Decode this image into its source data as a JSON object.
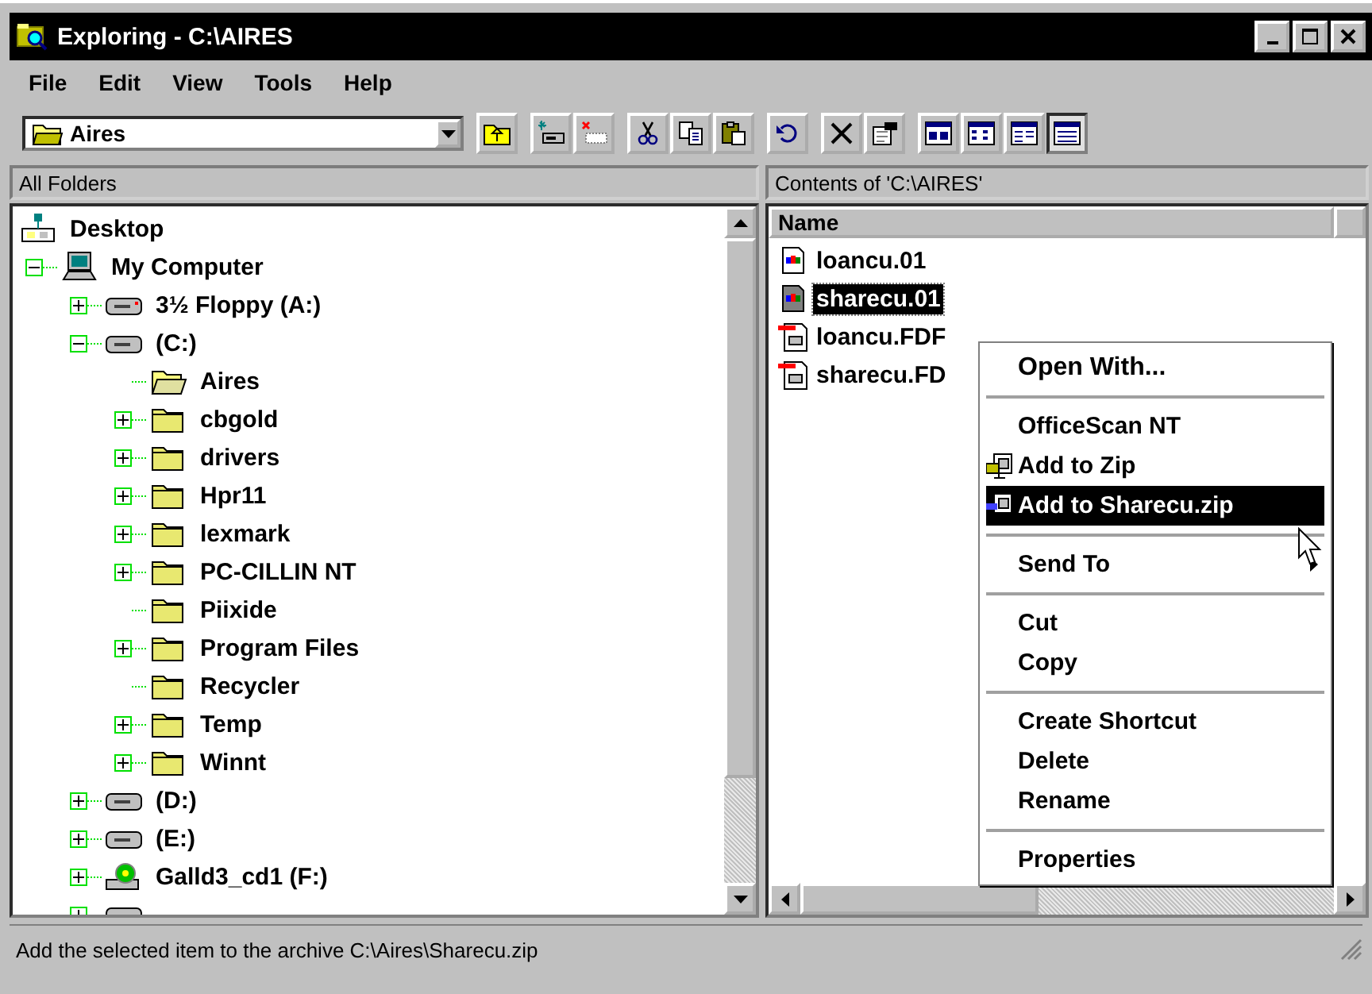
{
  "window": {
    "title": "Exploring - C:\\AIRES"
  },
  "menu": [
    {
      "label": "File"
    },
    {
      "label": "Edit"
    },
    {
      "label": "View"
    },
    {
      "label": "Tools"
    },
    {
      "label": "Help"
    }
  ],
  "toolbar": {
    "location": {
      "value": "Aires"
    },
    "buttons": [
      {
        "kind": "up",
        "selected": false
      },
      {
        "kind": "map-drive",
        "selected": false
      },
      {
        "kind": "disconnect",
        "selected": false
      },
      {
        "kind": "cut",
        "selected": false
      },
      {
        "kind": "copy",
        "selected": false
      },
      {
        "kind": "paste",
        "selected": false
      },
      {
        "kind": "undo",
        "selected": false
      },
      {
        "kind": "delete",
        "selected": false
      },
      {
        "kind": "properties",
        "selected": false
      },
      {
        "kind": "large-icons",
        "selected": false
      },
      {
        "kind": "small-icons",
        "selected": false
      },
      {
        "kind": "list",
        "selected": false
      },
      {
        "kind": "details",
        "selected": true
      }
    ]
  },
  "tree": {
    "header": "All Folders",
    "items": [
      {
        "label": "Desktop",
        "kind": "desktop",
        "children": [
          {
            "label": "My Computer",
            "kind": "computer",
            "expanded": true,
            "children": [
              {
                "label": "3½ Floppy (A:)",
                "kind": "floppy",
                "expanded": false
              },
              {
                "label": "(C:)",
                "kind": "drive",
                "expanded": true,
                "children": [
                  {
                    "label": "Aires",
                    "kind": "folder-open"
                  },
                  {
                    "label": "cbgold",
                    "kind": "folder",
                    "expanded": false
                  },
                  {
                    "label": "drivers",
                    "kind": "folder",
                    "expanded": false
                  },
                  {
                    "label": "Hpr11",
                    "kind": "folder",
                    "expanded": false
                  },
                  {
                    "label": "lexmark",
                    "kind": "folder",
                    "expanded": false
                  },
                  {
                    "label": "PC-CILLIN NT",
                    "kind": "folder",
                    "expanded": false
                  },
                  {
                    "label": "Piixide",
                    "kind": "folder"
                  },
                  {
                    "label": "Program Files",
                    "kind": "folder",
                    "expanded": false
                  },
                  {
                    "label": "Recycler",
                    "kind": "folder"
                  },
                  {
                    "label": "Temp",
                    "kind": "folder",
                    "expanded": false
                  },
                  {
                    "label": "Winnt",
                    "kind": "folder",
                    "expanded": false
                  }
                ]
              },
              {
                "label": "(D:)",
                "kind": "drive",
                "expanded": false
              },
              {
                "label": "(E:)",
                "kind": "drive",
                "expanded": false
              },
              {
                "label": "Galld3_cd1 (F:)",
                "kind": "cdrom",
                "expanded": false
              },
              {
                "kind": "network-drive",
                "expanded": false
              }
            ]
          }
        ]
      }
    ]
  },
  "contents": {
    "header": "Contents of 'C:\\AIRES'",
    "columns": [
      "Name"
    ],
    "files": [
      {
        "name": "loancu.01",
        "kind": "data",
        "selected": false
      },
      {
        "name": "sharecu.01",
        "kind": "data",
        "selected": true
      },
      {
        "name": "loancu.FDF",
        "kind": "form",
        "selected": false
      },
      {
        "name": "sharecu.FD",
        "kind": "form",
        "selected": false
      }
    ]
  },
  "context_menu": {
    "items": [
      {
        "kind": "item",
        "label": "Open With...",
        "default": true,
        "selected": false
      },
      {
        "kind": "separator"
      },
      {
        "kind": "item",
        "label": "OfficeScan NT",
        "selected": false
      },
      {
        "kind": "zip-item",
        "label": "Add to Zip",
        "selected": false
      },
      {
        "kind": "zip-file-item",
        "label": "Add to Sharecu.zip",
        "selected": true
      },
      {
        "kind": "separator"
      },
      {
        "kind": "item",
        "label": "Send To",
        "submenu": true,
        "selected": false
      },
      {
        "kind": "separator"
      },
      {
        "kind": "item",
        "label": "Cut",
        "selected": false
      },
      {
        "kind": "item",
        "label": "Copy",
        "selected": false
      },
      {
        "kind": "separator"
      },
      {
        "kind": "item",
        "label": "Create Shortcut",
        "selected": false
      },
      {
        "kind": "item",
        "label": "Delete",
        "selected": false
      },
      {
        "kind": "item",
        "label": "Rename",
        "selected": false
      },
      {
        "kind": "separator"
      },
      {
        "kind": "item",
        "label": "Properties",
        "selected": false
      }
    ]
  },
  "status_bar": {
    "text": "Add the selected item to the archive C:\\Aires\\Sharecu.zip"
  }
}
